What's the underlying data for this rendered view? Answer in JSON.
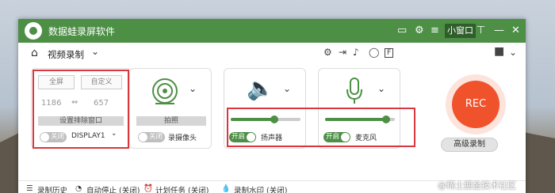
{
  "app": {
    "title": "数据蛙录屏软件"
  },
  "titlebar": {
    "mini_label": "小窗口"
  },
  "toolbar": {
    "mode_label": "视频录制"
  },
  "screen_panel": {
    "fullscreen_label": "全屏",
    "custom_label": "自定义",
    "width": "1186",
    "height": "657",
    "exclude_label": "设置排除窗口",
    "toggle_label": "关闭",
    "display_label": "DISPLAY1"
  },
  "camera_panel": {
    "photo_label": "拍照",
    "toggle_label": "关闭",
    "label": "录摄像头"
  },
  "speaker_panel": {
    "toggle_label": "开启",
    "label": "扬声器",
    "volume": 0.62
  },
  "mic_panel": {
    "toggle_label": "开启",
    "label": "麦克风",
    "volume": 0.88
  },
  "rec": {
    "label": "REC",
    "advanced_label": "高级录制"
  },
  "footer": {
    "history": "录制历史",
    "auto_stop": "自动停止 (关闭)",
    "schedule": "计划任务 (关闭)",
    "watermark": "录制水印 (关闭)"
  },
  "page_watermark": "@稀土掘金技术社区",
  "colors": {
    "brand_green": "#4c8f45",
    "rec_red": "#f0522c",
    "highlight_red": "#d9363e"
  }
}
